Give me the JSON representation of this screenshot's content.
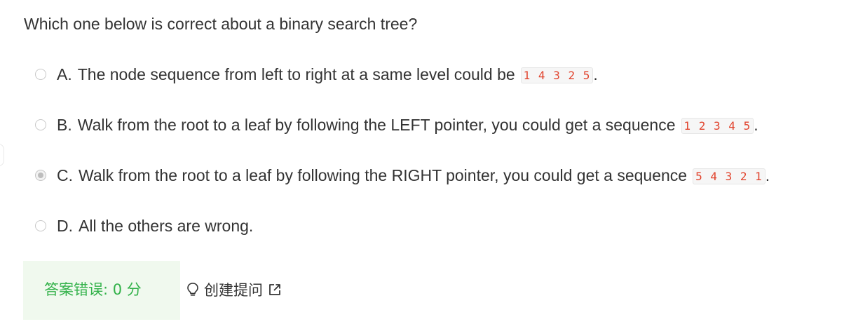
{
  "question": {
    "text": "Which one below is correct about a binary search tree?"
  },
  "options": [
    {
      "letter": "A.",
      "text": "The node sequence from left to right at a same level could be",
      "sequence": "1 4 3 2 5",
      "suffix": ".",
      "selected": false
    },
    {
      "letter": "B.",
      "text": "Walk from the root to a leaf by following the LEFT pointer, you could get a sequence",
      "sequence": "1 2 3 4 5",
      "suffix": ".",
      "selected": false
    },
    {
      "letter": "C.",
      "text": "Walk from the root to a leaf by following the RIGHT pointer, you could get a sequence",
      "sequence": "5 4 3 2 1",
      "suffix": ".",
      "selected": true
    },
    {
      "letter": "D.",
      "text": "All the others are wrong.",
      "sequence": "",
      "suffix": "",
      "selected": false
    }
  ],
  "result": {
    "label": "答案错误: 0 分",
    "color": "#33b24a",
    "background": "#f0f9ee"
  },
  "ask": {
    "label": "创建提问",
    "icon": "lightbulb-icon",
    "link_icon": "external-link-icon"
  },
  "colors": {
    "code_text": "#e1442e",
    "code_background": "#f6f6f6",
    "body_text": "#333333"
  }
}
